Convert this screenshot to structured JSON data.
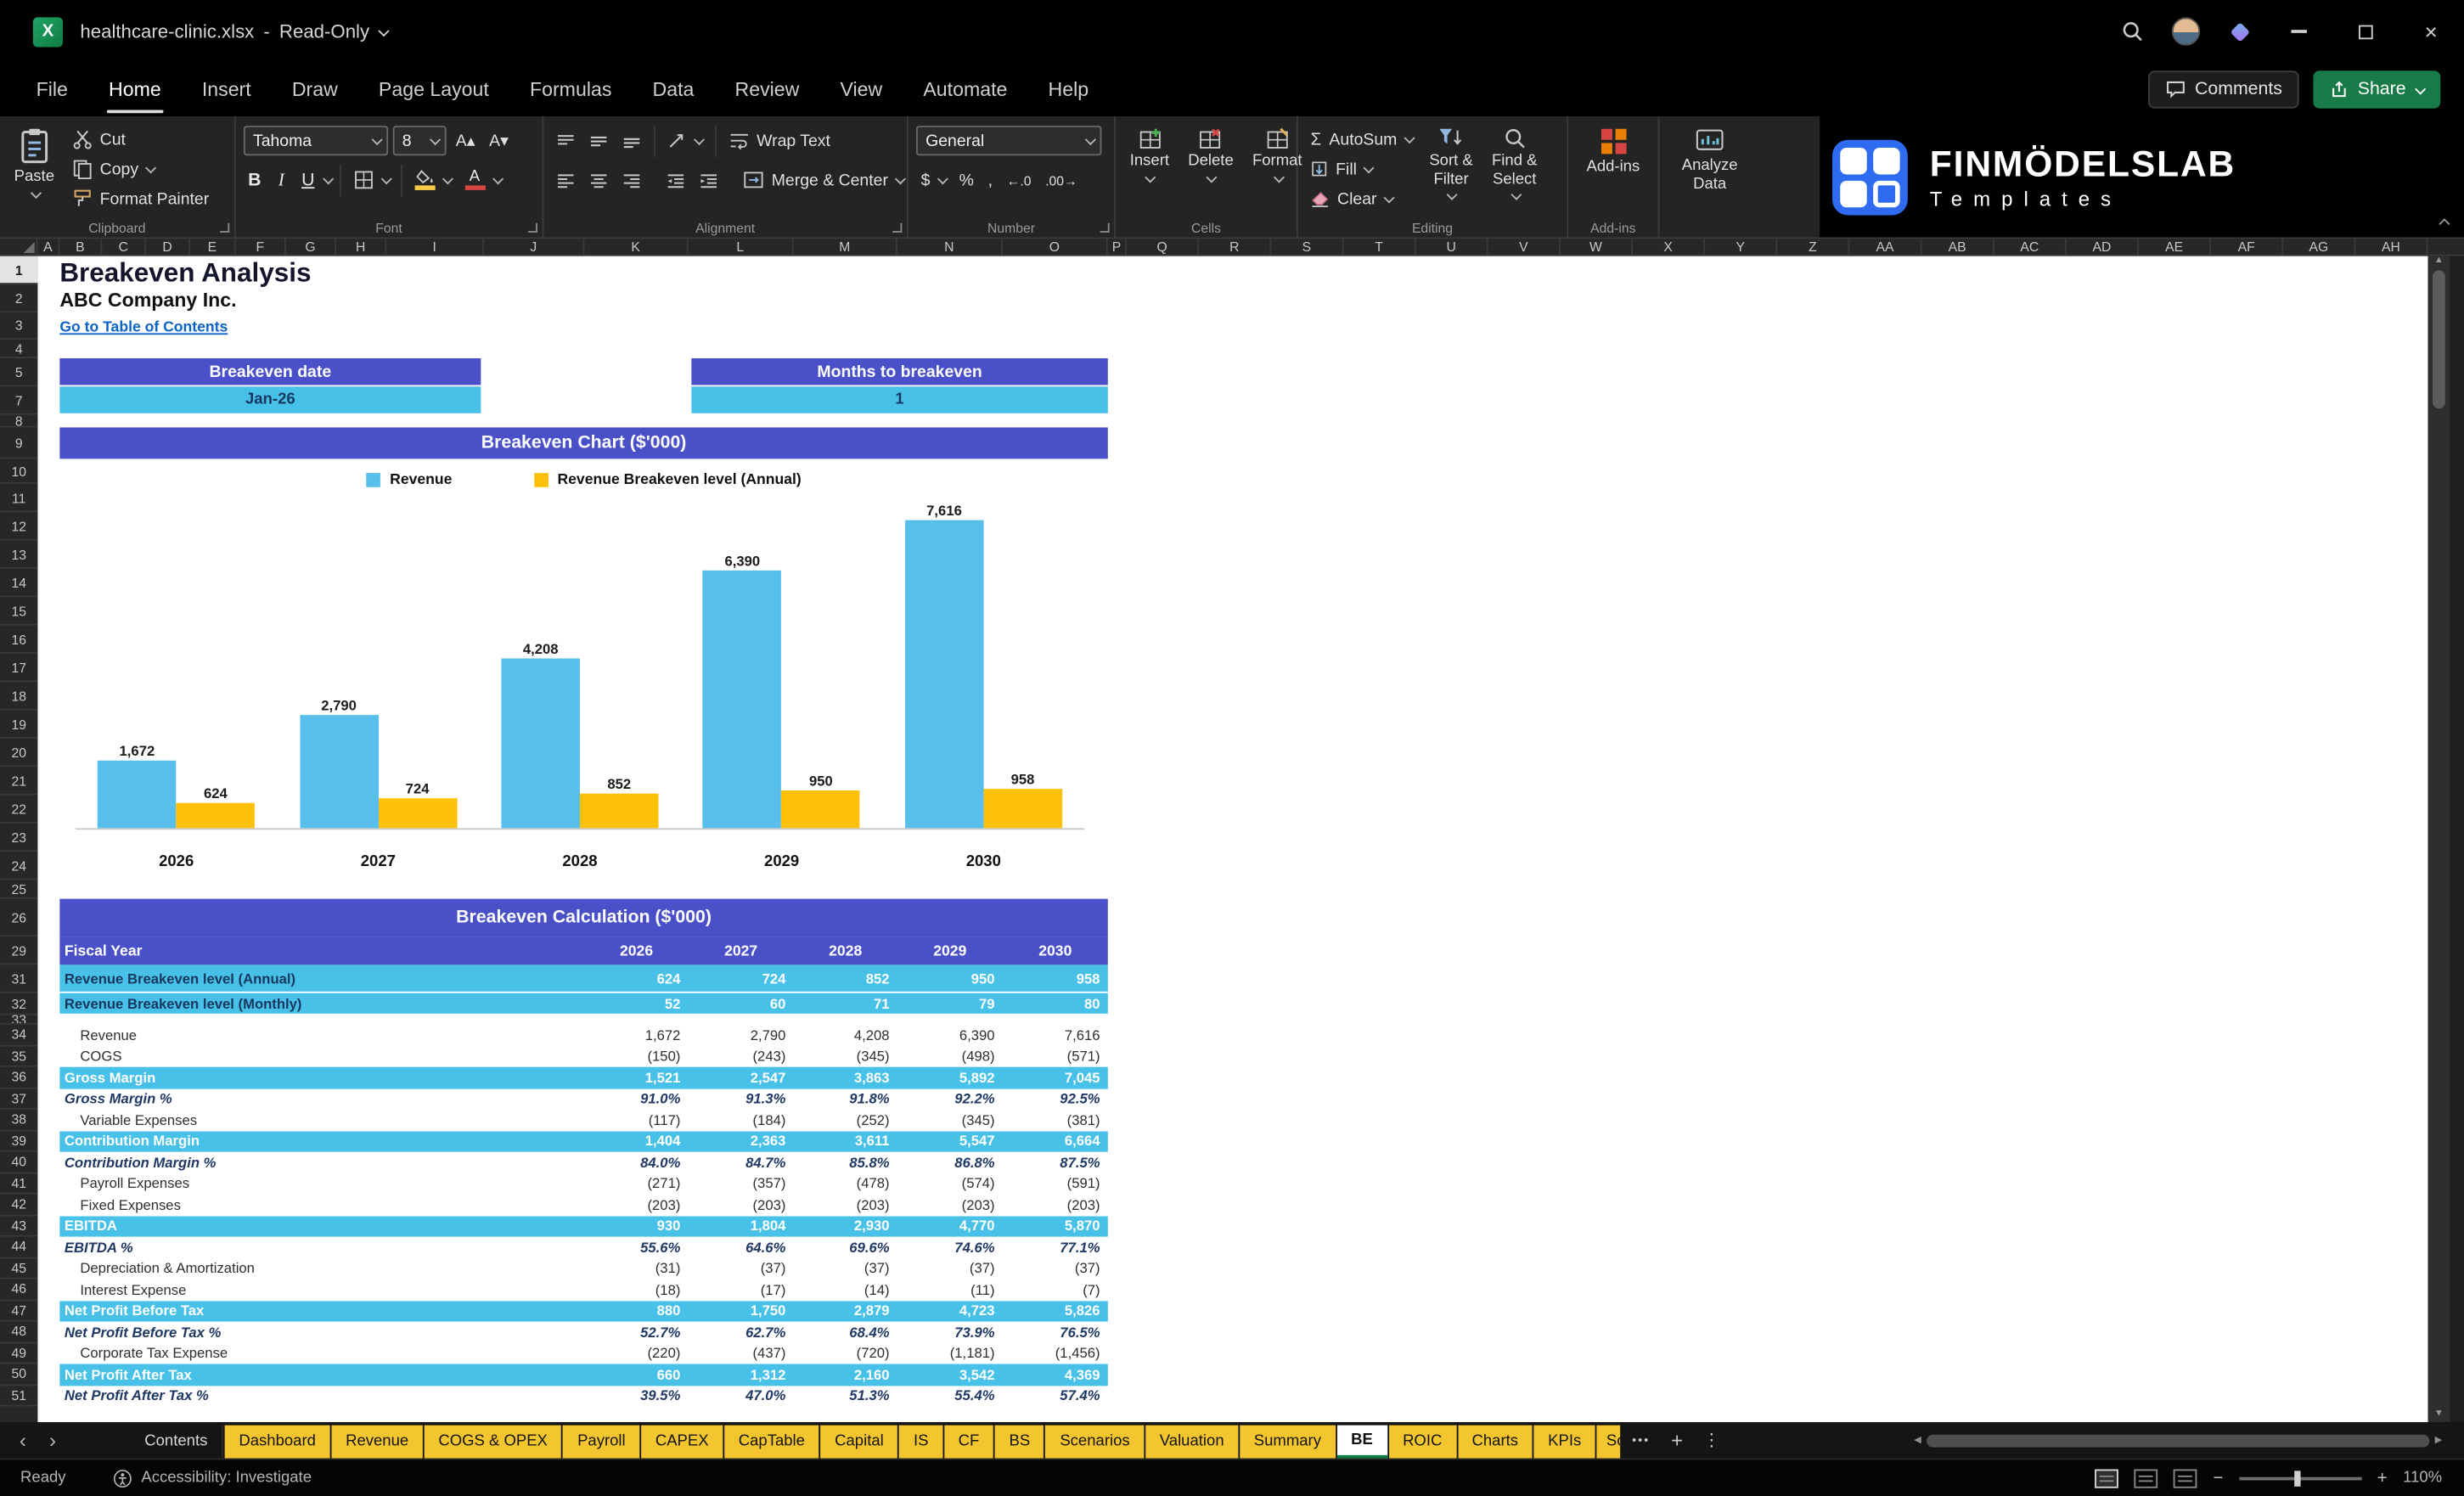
{
  "colors": {
    "header_purple": "#4A50C8",
    "band_cyan": "#47C1E8",
    "bar_blue": "#58BEEB",
    "bar_yellow": "#FFC107",
    "tab_yellow": "#F3C52F",
    "navy_text": "#17375E",
    "link_blue": "#0D64C8",
    "excel_green": "#107C41"
  },
  "icons": {
    "chevron_left": "‹",
    "chevron_right": "›",
    "more_tabs": "•••",
    "new_sheet": "+",
    "tab_menu": "⋮",
    "close": "×",
    "excel_logo_letter": "X",
    "scroll_up": "▲",
    "scroll_down": "▼",
    "scroll_left": "◀",
    "scroll_right": "▶",
    "increase_decimal": "←.0",
    "decrease_decimal": ".00→",
    "sigma": "Σ",
    "zoom_out": "−",
    "zoom_in": "+",
    "grow_font": "A▴",
    "shrink_font": "A▾"
  },
  "titlebar": {
    "filename": "healthcare-clinic.xlsx",
    "separator": "-",
    "mode": "Read-Only"
  },
  "menubar": {
    "items": [
      "File",
      "Home",
      "Insert",
      "Draw",
      "Page Layout",
      "Formulas",
      "Data",
      "Review",
      "View",
      "Automate",
      "Help"
    ],
    "active_item": "Home",
    "comments": "Comments",
    "share": "Share"
  },
  "ribbon": {
    "clipboard": {
      "group": "Clipboard",
      "paste": "Paste",
      "cut": "Cut",
      "copy": "Copy",
      "format_painter": "Format Painter"
    },
    "font": {
      "group": "Font",
      "family": "Tahoma",
      "size": "8",
      "bold": "B",
      "italic": "I",
      "underline": "U"
    },
    "alignment": {
      "group": "Alignment",
      "wrap": "Wrap Text",
      "merge": "Merge & Center"
    },
    "number": {
      "group": "Number",
      "format": "General",
      "currency": "$",
      "percent": "%",
      "comma": ","
    },
    "cells": {
      "group": "Cells",
      "insert": "Insert",
      "delete": "Delete",
      "format": "Format"
    },
    "editing": {
      "group": "Editing",
      "autosum": "AutoSum",
      "fill": "Fill",
      "clear": "Clear",
      "sort_line1": "Sort &",
      "sort_line2": "Filter",
      "find_line1": "Find &",
      "find_line2": "Select"
    },
    "addins": {
      "group": "Add-ins",
      "addins": "Add-ins",
      "analyze_line1": "Analyze",
      "analyze_line2": "Data"
    },
    "brand": {
      "name": "FINMÖDELSLAB",
      "sub": "Templates"
    }
  },
  "grid": {
    "columns": [
      "A",
      "B",
      "C",
      "D",
      "E",
      "F",
      "G",
      "H",
      "I",
      "J",
      "K",
      "L",
      "M",
      "N",
      "O",
      "P",
      "Q",
      "R",
      "S",
      "T",
      "U",
      "V",
      "W",
      "X",
      "Y",
      "Z",
      "AA",
      "AB",
      "AC",
      "AD",
      "AE",
      "AF",
      "AG",
      "AH"
    ],
    "rows": [
      1,
      2,
      3,
      4,
      5,
      7,
      8,
      9,
      10,
      11,
      12,
      13,
      14,
      15,
      16,
      17,
      18,
      19,
      20,
      21,
      22,
      23,
      24,
      25,
      26,
      29,
      31,
      32,
      33,
      34,
      35,
      36,
      37,
      38,
      39,
      40,
      41,
      42,
      43,
      44,
      45,
      46,
      47,
      48,
      49,
      50,
      51
    ],
    "selected_row": 1
  },
  "sheet": {
    "title": "Breakeven Analysis",
    "company": "ABC Company Inc.",
    "toc_link": "Go to Table of Contents",
    "kpis": [
      {
        "label": "Breakeven date",
        "value": "Jan-26"
      },
      {
        "label": "Months to breakeven",
        "value": "1"
      }
    ]
  },
  "chart_data": {
    "type": "bar",
    "title": "Breakeven Chart ($'000)",
    "categories": [
      "2026",
      "2027",
      "2028",
      "2029",
      "2030"
    ],
    "series": [
      {
        "name": "Revenue",
        "color": "#58BEEB",
        "values": [
          1672,
          2790,
          4208,
          6390,
          7616
        ],
        "labels": [
          "1,672",
          "2,790",
          "4,208",
          "6,390",
          "7,616"
        ]
      },
      {
        "name": "Revenue Breakeven level (Annual)",
        "color": "#FFC107",
        "values": [
          624,
          724,
          852,
          950,
          958
        ],
        "labels": [
          "624",
          "724",
          "852",
          "950",
          "958"
        ]
      }
    ],
    "ylim": [
      0,
      8000
    ],
    "grid": false,
    "legend_position": "top"
  },
  "table": {
    "title": "Breakeven Calculation ($'000)",
    "header_label": "Fiscal Year",
    "years": [
      "2026",
      "2027",
      "2028",
      "2029",
      "2030"
    ],
    "rows": [
      {
        "label": "Revenue Breakeven level (Annual)",
        "values": [
          "624",
          "724",
          "852",
          "950",
          "958"
        ],
        "style": "band",
        "indent": false
      },
      {
        "label": "Revenue Breakeven level (Monthly)",
        "values": [
          "52",
          "60",
          "71",
          "79",
          "80"
        ],
        "style": "band",
        "indent": false
      },
      {
        "label": "Revenue",
        "values": [
          "1,672",
          "2,790",
          "4,208",
          "6,390",
          "7,616"
        ],
        "style": "plain",
        "indent": true
      },
      {
        "label": "COGS",
        "values": [
          "(150)",
          "(243)",
          "(345)",
          "(498)",
          "(571)"
        ],
        "style": "plain",
        "indent": true
      },
      {
        "label": "Gross Margin",
        "values": [
          "1,521",
          "2,547",
          "3,863",
          "5,892",
          "7,045"
        ],
        "style": "subtotal",
        "indent": false
      },
      {
        "label": "Gross Margin %",
        "values": [
          "91.0%",
          "91.3%",
          "91.8%",
          "92.2%",
          "92.5%"
        ],
        "style": "percent",
        "indent": false
      },
      {
        "label": "Variable Expenses",
        "values": [
          "(117)",
          "(184)",
          "(252)",
          "(345)",
          "(381)"
        ],
        "style": "plain",
        "indent": true
      },
      {
        "label": "Contribution Margin",
        "values": [
          "1,404",
          "2,363",
          "3,611",
          "5,547",
          "6,664"
        ],
        "style": "subtotal",
        "indent": false
      },
      {
        "label": "Contribution Margin %",
        "values": [
          "84.0%",
          "84.7%",
          "85.8%",
          "86.8%",
          "87.5%"
        ],
        "style": "percent",
        "indent": false
      },
      {
        "label": "Payroll Expenses",
        "values": [
          "(271)",
          "(357)",
          "(478)",
          "(574)",
          "(591)"
        ],
        "style": "plain",
        "indent": true
      },
      {
        "label": "Fixed Expenses",
        "values": [
          "(203)",
          "(203)",
          "(203)",
          "(203)",
          "(203)"
        ],
        "style": "plain",
        "indent": true
      },
      {
        "label": "EBITDA",
        "values": [
          "930",
          "1,804",
          "2,930",
          "4,770",
          "5,870"
        ],
        "style": "subtotal",
        "indent": false
      },
      {
        "label": "EBITDA %",
        "values": [
          "55.6%",
          "64.6%",
          "69.6%",
          "74.6%",
          "77.1%"
        ],
        "style": "percent",
        "indent": false
      },
      {
        "label": "Depreciation & Amortization",
        "values": [
          "(31)",
          "(37)",
          "(37)",
          "(37)",
          "(37)"
        ],
        "style": "plain",
        "indent": true
      },
      {
        "label": "Interest Expense",
        "values": [
          "(18)",
          "(17)",
          "(14)",
          "(11)",
          "(7)"
        ],
        "style": "plain",
        "indent": true
      },
      {
        "label": "Net Profit Before Tax",
        "values": [
          "880",
          "1,750",
          "2,879",
          "4,723",
          "5,826"
        ],
        "style": "subtotal",
        "indent": false
      },
      {
        "label": "Net Profit Before Tax %",
        "values": [
          "52.7%",
          "62.7%",
          "68.4%",
          "73.9%",
          "76.5%"
        ],
        "style": "percent",
        "indent": false
      },
      {
        "label": "Corporate Tax Expense",
        "values": [
          "(220)",
          "(437)",
          "(720)",
          "(1,181)",
          "(1,456)"
        ],
        "style": "plain",
        "indent": true
      },
      {
        "label": "Net Profit After Tax",
        "values": [
          "660",
          "1,312",
          "2,160",
          "3,542",
          "4,369"
        ],
        "style": "subtotal",
        "indent": false
      },
      {
        "label": "Net Profit After Tax %",
        "values": [
          "39.5%",
          "47.0%",
          "51.3%",
          "55.4%",
          "57.4%"
        ],
        "style": "percent",
        "indent": false
      }
    ]
  },
  "sheet_tabs": {
    "tabs": [
      {
        "label": "Contents",
        "style": "dark"
      },
      {
        "label": "Dashboard",
        "style": "yellow"
      },
      {
        "label": "Revenue",
        "style": "yellow"
      },
      {
        "label": "COGS & OPEX",
        "style": "yellow"
      },
      {
        "label": "Payroll",
        "style": "yellow"
      },
      {
        "label": "CAPEX",
        "style": "yellow"
      },
      {
        "label": "CapTable",
        "style": "yellow"
      },
      {
        "label": "Capital",
        "style": "yellow"
      },
      {
        "label": "IS",
        "style": "yellow"
      },
      {
        "label": "CF",
        "style": "yellow"
      },
      {
        "label": "BS",
        "style": "yellow"
      },
      {
        "label": "Scenarios",
        "style": "yellow"
      },
      {
        "label": "Valuation",
        "style": "yellow"
      },
      {
        "label": "Summary",
        "style": "yellow"
      },
      {
        "label": "BE",
        "style": "active"
      },
      {
        "label": "ROIC",
        "style": "yellow"
      },
      {
        "label": "Charts",
        "style": "yellow"
      },
      {
        "label": "KPIs",
        "style": "yellow"
      },
      {
        "label": "So",
        "style": "yellow cut"
      }
    ]
  },
  "statusbar": {
    "ready": "Ready",
    "accessibility": "Accessibility: Investigate",
    "zoom": "110%"
  }
}
